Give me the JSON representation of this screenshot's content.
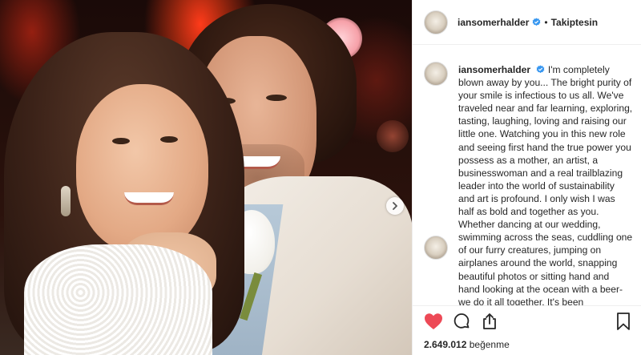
{
  "post": {
    "username": "iansomerhalder",
    "follow_status": "Takiptesin",
    "caption_user": "iansomerhalder",
    "caption_text": "I'm completely blown away by you... The bright purity of your smile is infectious to us all. We've traveled near and far learning, exploring, tasting, laughing, loving and raising our little one. Watching you in this new role and seeing first hand the true power you possess as a mother, an artist, a businesswoman and a real trailblazing leader into the world of sustainability and art is profound. I only wish I was half as bold and together as you. Whether dancing at our wedding, swimming across the seas, cuddling one of our furry creatures, jumping on airplanes around the world, snapping beautiful photos or sitting hand and hand looking at the ocean with a beer-we do it all together. It's been",
    "likes_count": "2.649.012",
    "likes_label": "beğenme"
  },
  "colors": {
    "like_red": "#ed4956",
    "verified_blue": "#3897f0",
    "text": "#262626"
  },
  "icons": {
    "like": "heart-icon",
    "comment": "comment-icon",
    "share": "share-icon",
    "save": "bookmark-icon",
    "verified": "verified-badge-icon",
    "next": "chevron-right-icon"
  }
}
